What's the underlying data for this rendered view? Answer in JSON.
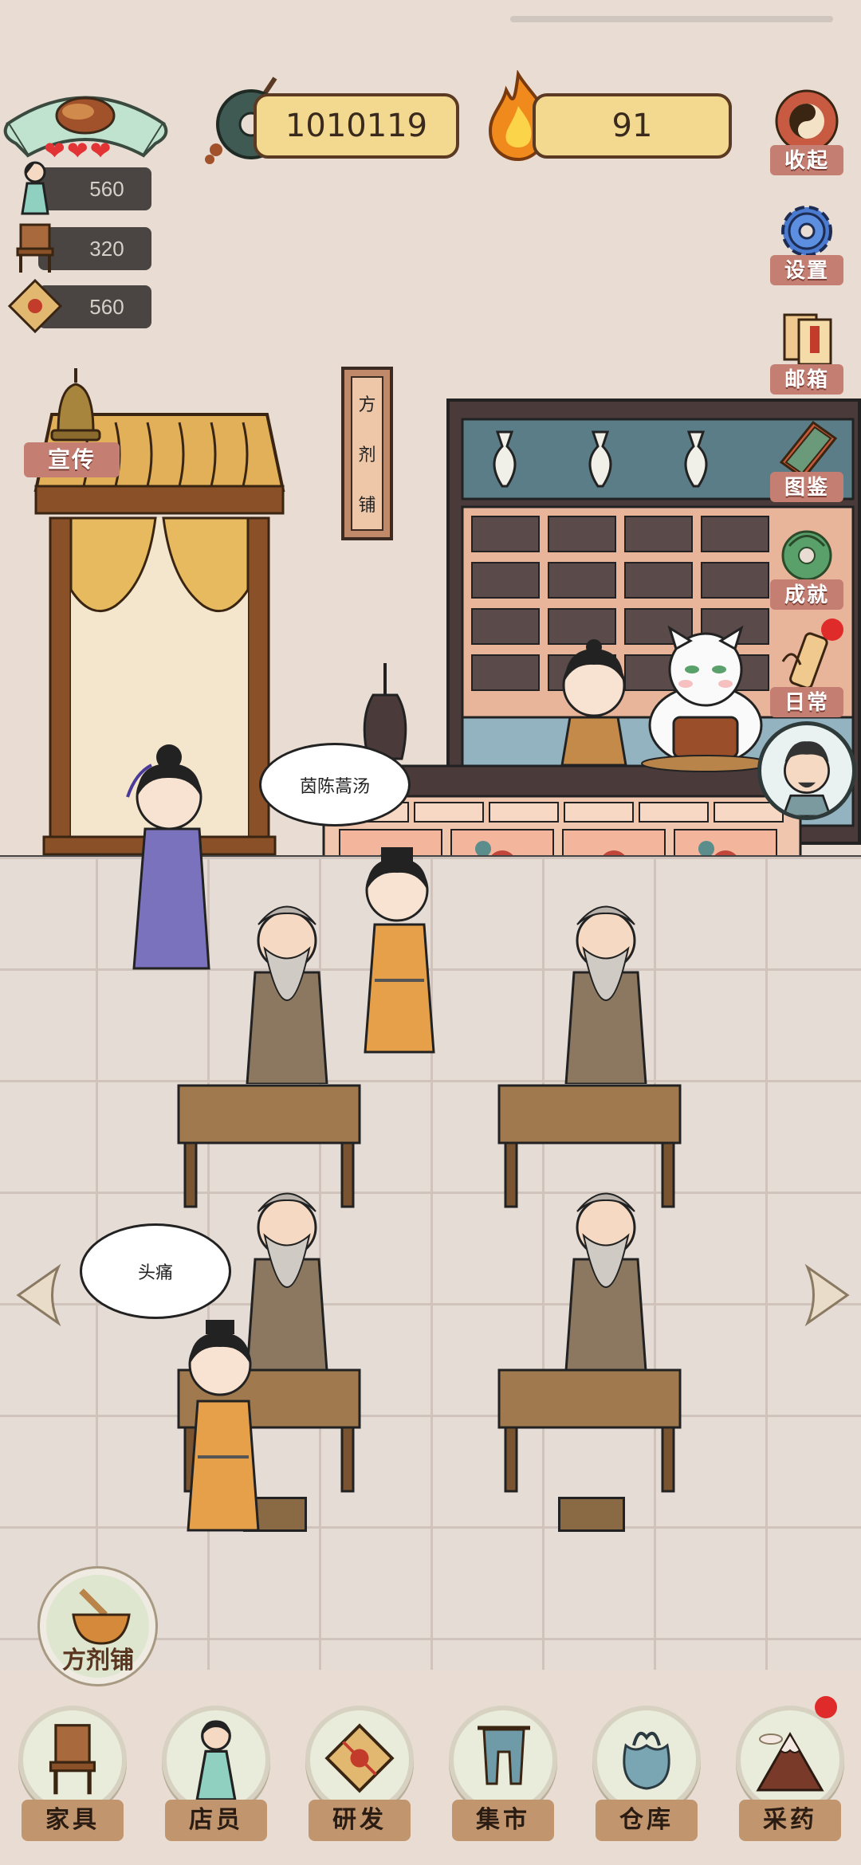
{
  "resources": {
    "coins": "1010119",
    "energy": "91"
  },
  "stats": [
    {
      "icon": "staff-icon",
      "value": "560"
    },
    {
      "icon": "chair-icon",
      "value": "320"
    },
    {
      "icon": "package-icon",
      "value": "560"
    }
  ],
  "hearts": 3,
  "side_menu": {
    "collapse": "收起",
    "settings": "设置",
    "mailbox": "邮箱",
    "catalog": "图鉴",
    "achievements": "成就",
    "daily": "日常"
  },
  "promote": "宣传",
  "shop_sign": "方剂铺",
  "bubbles": {
    "counter_customer": "茵陈蒿汤",
    "waiting_customer": "头痛"
  },
  "shop_button": "方剂铺",
  "nav": [
    {
      "label": "家具",
      "icon": "chair-icon",
      "badge": false
    },
    {
      "label": "店员",
      "icon": "staff-icon",
      "badge": false
    },
    {
      "label": "研发",
      "icon": "package-icon",
      "badge": false
    },
    {
      "label": "集市",
      "icon": "market-icon",
      "badge": false
    },
    {
      "label": "仓库",
      "icon": "bag-icon",
      "badge": false
    },
    {
      "label": "采药",
      "icon": "mountain-icon",
      "badge": true
    }
  ],
  "colors": {
    "background": "#e8dcd3",
    "counter_fill": "#f3d98f",
    "label_red": "#c47e72",
    "nav_label": "#c1956e",
    "badge": "#e02b2b"
  }
}
